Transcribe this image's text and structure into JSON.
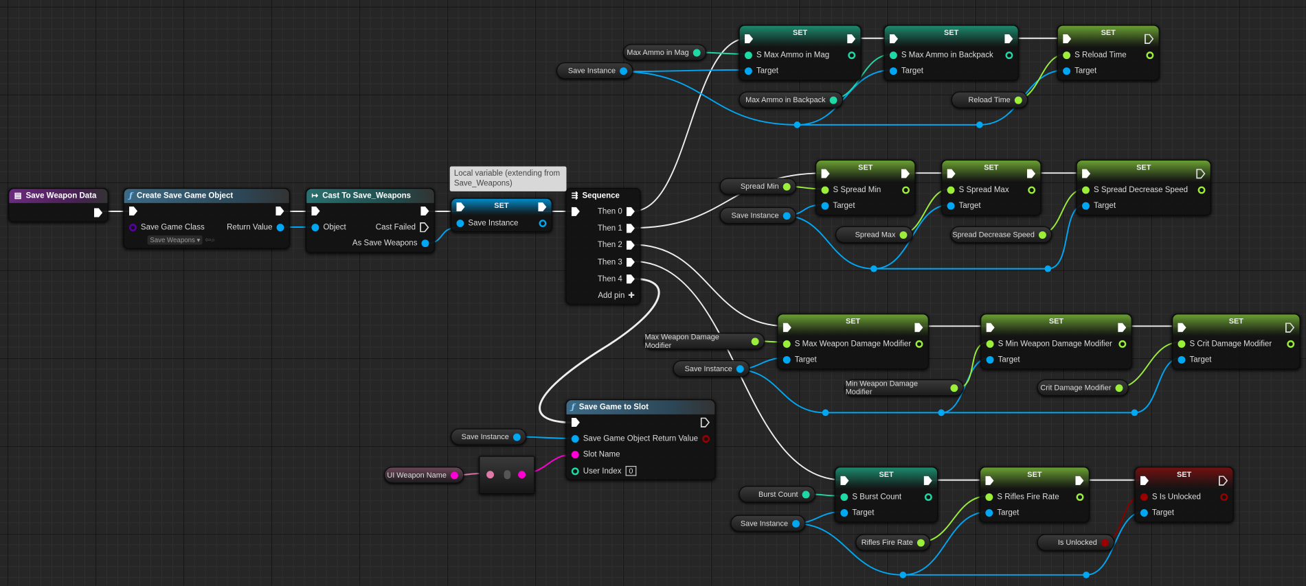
{
  "graph_title": "",
  "colors": {
    "exec": "#ffffff",
    "object": "#00a8f4",
    "integer": "#1ed9a6",
    "float": "#9bef3b",
    "boolean": "#9a0000",
    "string": "#ff00d4",
    "class": "#5a00a8",
    "event_header": "#6b2a7e",
    "function_header": "#3d6a85",
    "cast_header": "#2a7070"
  },
  "event": {
    "title": "Save Weapon Data",
    "icon": "event-icon"
  },
  "create_save_game_object": {
    "title": "Create Save Game Object",
    "icon": "function-icon",
    "save_game_class": "Save Game Class",
    "class_value": "Save Weapons",
    "return_value": "Return Value"
  },
  "cast": {
    "title": "Cast To Save_Weapons",
    "icon": "cast-icon",
    "object": "Object",
    "cast_failed": "Cast Failed",
    "as_save_weapons": "As Save Weapons"
  },
  "set_save_instance": {
    "title": "SET",
    "var": "Save Instance",
    "tooltip": "Local variable (extending from Save_Weapons)"
  },
  "sequence": {
    "title": "Sequence",
    "icon": "sequence-icon",
    "outputs": [
      "Then 0",
      "Then 1",
      "Then 2",
      "Then 3",
      "Then 4"
    ],
    "add_pin": "Add pin"
  },
  "save_game_to_slot": {
    "title": "Save Game to Slot",
    "icon": "function-icon",
    "save_game_object": "Save Game Object",
    "return_value": "Return Value",
    "slot_name": "Slot Name",
    "user_index": "User Index",
    "user_index_value": "0"
  },
  "getters": [
    {
      "label": "Max Ammo in Mag",
      "type": "integer"
    },
    {
      "label": "Save Instance",
      "type": "object"
    },
    {
      "label": "Max Ammo in Backpack",
      "type": "integer"
    },
    {
      "label": "Reload Time",
      "type": "float"
    },
    {
      "label": "Spread Min",
      "type": "float"
    },
    {
      "label": "Save Instance",
      "type": "object"
    },
    {
      "label": "Spread Max",
      "type": "float"
    },
    {
      "label": "Spread Decrease Speed",
      "type": "float"
    },
    {
      "label": "Max Weapon Damage Modifier",
      "type": "float"
    },
    {
      "label": "Save Instance",
      "type": "object"
    },
    {
      "label": "Min Weapon Damage Modifier",
      "type": "float"
    },
    {
      "label": "Crit Damage Modifier",
      "type": "float"
    },
    {
      "label": "Burst Count",
      "type": "integer"
    },
    {
      "label": "Save Instance",
      "type": "object"
    },
    {
      "label": "Rifles Fire Rate",
      "type": "float"
    },
    {
      "label": "Is Unlocked",
      "type": "boolean"
    },
    {
      "label": "Save Instance",
      "type": "object"
    },
    {
      "label": "UI Weapon Name",
      "type": "string"
    }
  ],
  "setters": [
    {
      "title": "SET",
      "var": "S Max Ammo in Mag",
      "target": "Target",
      "type": "integer"
    },
    {
      "title": "SET",
      "var": "S Max Ammo in Backpack",
      "target": "Target",
      "type": "integer"
    },
    {
      "title": "SET",
      "var": "S Reload Time",
      "target": "Target",
      "type": "float"
    },
    {
      "title": "SET",
      "var": "S Spread Min",
      "target": "Target",
      "type": "float"
    },
    {
      "title": "SET",
      "var": "S Spread Max",
      "target": "Target",
      "type": "float"
    },
    {
      "title": "SET",
      "var": "S Spread Decrease Speed",
      "target": "Target",
      "type": "float"
    },
    {
      "title": "SET",
      "var": "S Max Weapon Damage Modifier",
      "target": "Target",
      "type": "float"
    },
    {
      "title": "SET",
      "var": "S Min Weapon Damage Modifier",
      "target": "Target",
      "type": "float"
    },
    {
      "title": "SET",
      "var": "S Crit Damage Modifier",
      "target": "Target",
      "type": "float"
    },
    {
      "title": "SET",
      "var": "S Burst Count",
      "target": "Target",
      "type": "integer"
    },
    {
      "title": "SET",
      "var": "S Rifles Fire Rate",
      "target": "Target",
      "type": "float"
    },
    {
      "title": "SET",
      "var": "S Is Unlocked",
      "target": "Target",
      "type": "boolean"
    }
  ]
}
